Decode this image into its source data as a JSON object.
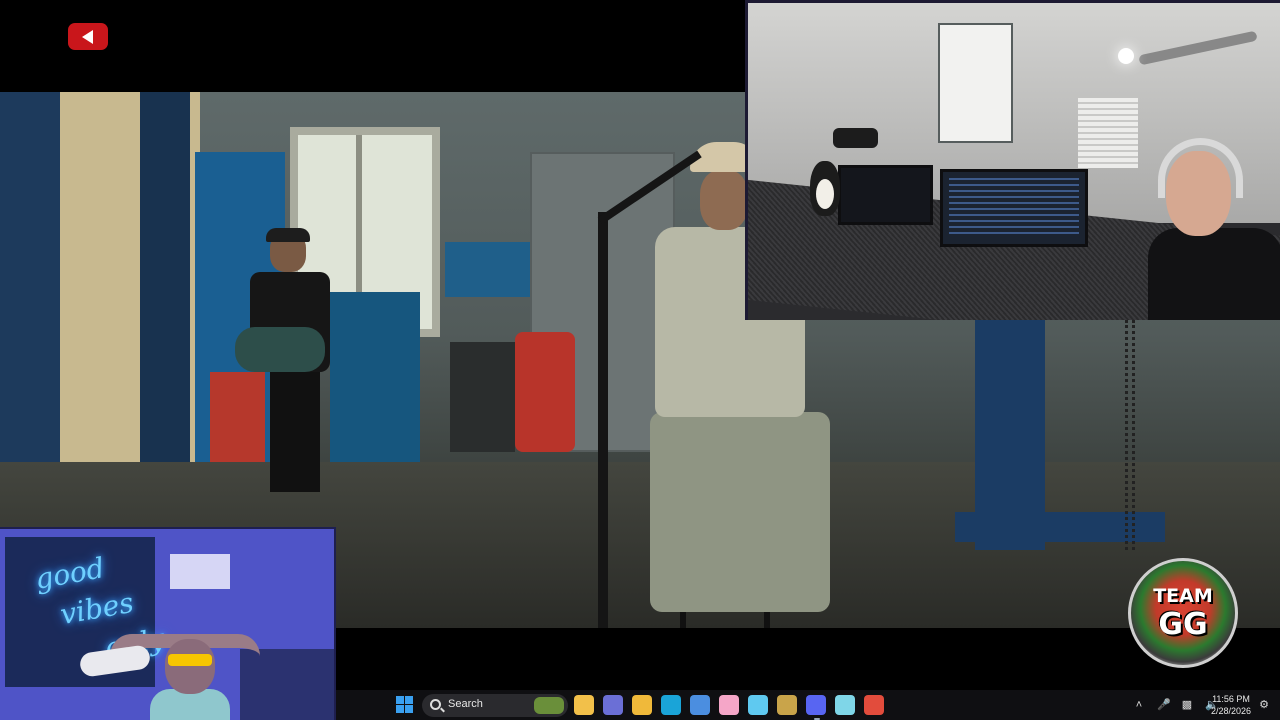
{
  "taskbar": {
    "search_label": "Search",
    "time": "11:56 PM",
    "date": "2/28/2026",
    "apps": [
      {
        "name": "file-explorer-icon",
        "color": "#f2c04a"
      },
      {
        "name": "teams-icon",
        "color": "#6b6fd6"
      },
      {
        "name": "folder-icon",
        "color": "#f0b93a"
      },
      {
        "name": "edge-icon",
        "color": "#1aa4d8"
      },
      {
        "name": "store-icon",
        "color": "#4b8ee0"
      },
      {
        "name": "pink-app-icon",
        "color": "#f5a6c8"
      },
      {
        "name": "copilot-icon",
        "color": "#5fc9f0"
      },
      {
        "name": "puzzle-app-icon",
        "color": "#c9a44a"
      },
      {
        "name": "discord-icon",
        "color": "#5865f2"
      },
      {
        "name": "notepad-icon",
        "color": "#7fd6e8"
      },
      {
        "name": "chrome-icon",
        "color": "#e24c3c"
      }
    ]
  },
  "overlay": {
    "team_line1": "TEAM",
    "team_line2": "GG"
  },
  "neon_sign": {
    "line1": "good",
    "line2": "vibes",
    "line3": "only"
  },
  "colors": {
    "taskbar_bg": "#0f0f12",
    "windows_accent": "#3aa0f0",
    "youtube_red": "#c9161b"
  }
}
